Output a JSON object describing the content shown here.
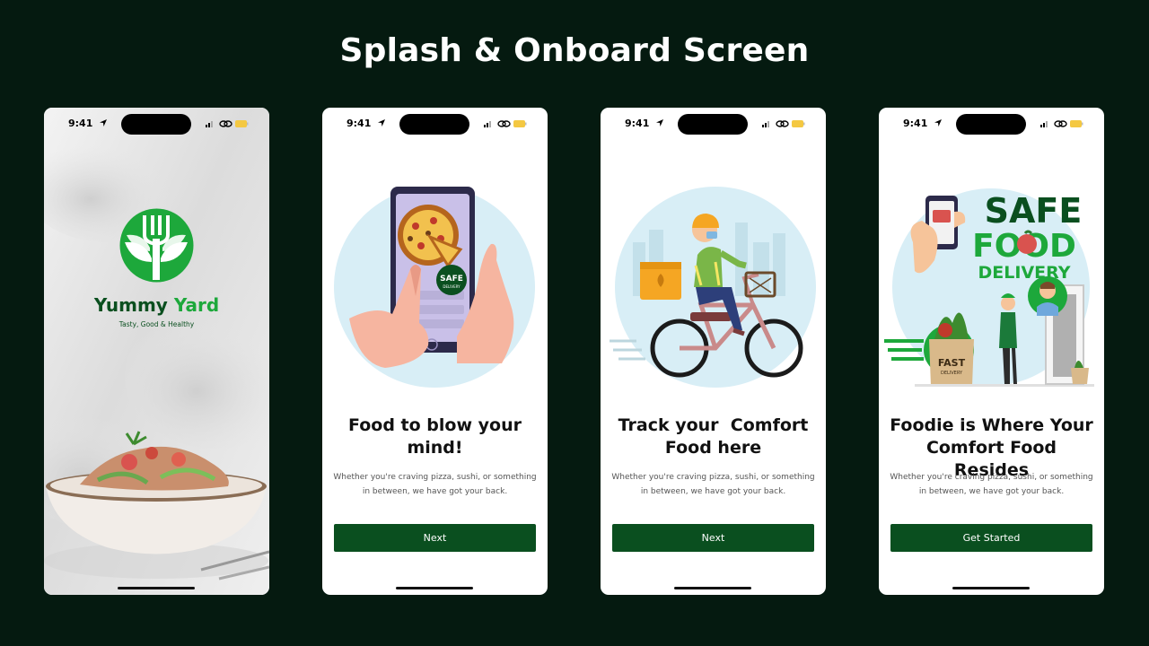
{
  "page_title": "Splash & Onboard Screen",
  "status_bar": {
    "time": "9:41"
  },
  "colors": {
    "accent": "#0A4F1F",
    "brand_green": "#1DA83B",
    "background": "#051A10"
  },
  "splash": {
    "brand_first": "Yummy",
    "brand_second": "Yard",
    "tagline": "Tasty, Good & Healthy"
  },
  "onboarding": [
    {
      "title": "Food to blow your mind!",
      "description": "Whether you're craving pizza, sushi, or something in between, we have got your back.",
      "button": "Next",
      "badge_text": "SAFE",
      "badge_sub": "DELIVERY"
    },
    {
      "title": "Track your  Comfort Food here",
      "description": "Whether you're craving pizza, sushi, or something in between, we have got your back.",
      "button": "Next"
    },
    {
      "title": "Foodie is Where Your Comfort Food Resides",
      "description": "Whether you're craving pizza, sushi, or something in between, we have got your back.",
      "button": "Get Started",
      "headline_1": "SAFE",
      "headline_2": "FOOD",
      "headline_3": "DELIVERY",
      "bag_text": "FAST",
      "bag_sub": "DELIVERY"
    }
  ],
  "icons": [
    "location-arrow-icon",
    "signal-icon",
    "link-icon",
    "battery-icon",
    "fork-leaf-logo-icon"
  ]
}
